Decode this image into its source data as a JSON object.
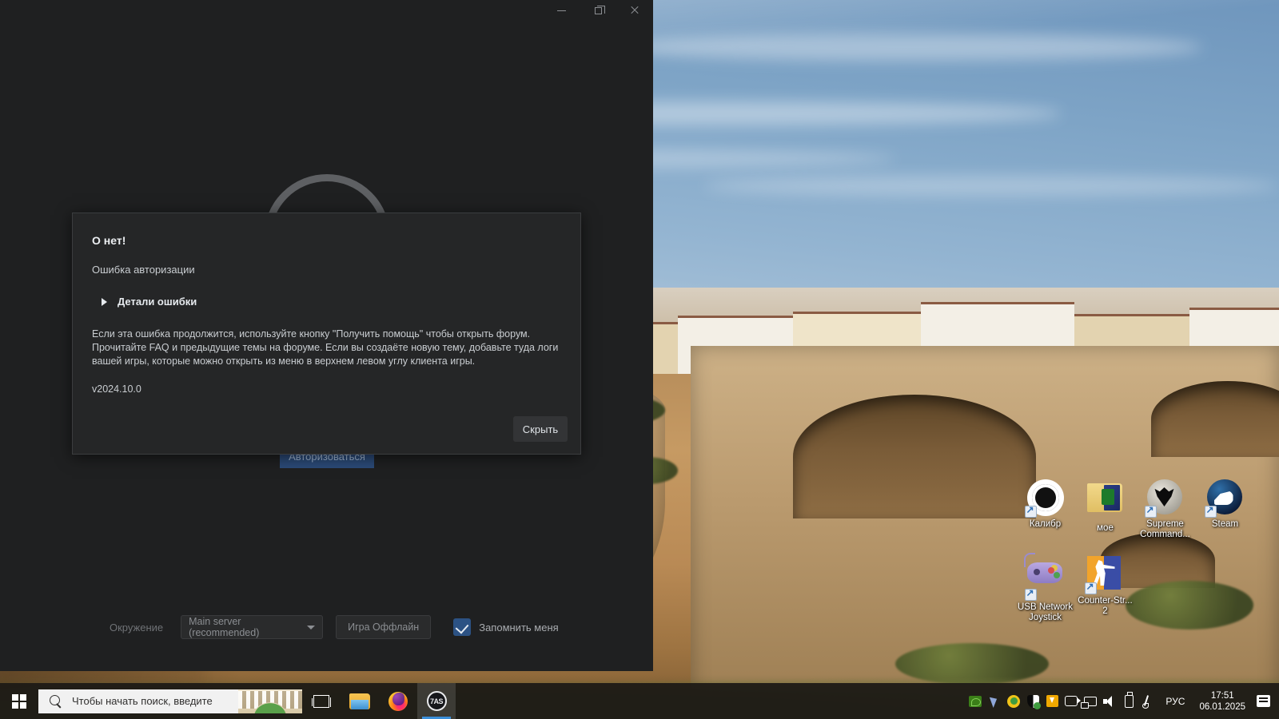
{
  "app": {
    "titlebar": {
      "minimize_label": "Свернуть",
      "restore_label": "Развернуть",
      "close_label": "Закрыть"
    },
    "login_button_label": "Авторизоваться",
    "bottom_bar": {
      "environment_label": "Окружение",
      "server_select_value": "Main server (recommended)",
      "offline_button_label": "Игра Оффлайн",
      "remember_me_label": "Запомнить меня",
      "remember_me_checked": true,
      "checkbox_color": "#2c5284"
    },
    "dialog": {
      "title": "О нет!",
      "subtitle": "Ошибка авторизации",
      "details_toggle_label": "Детали ошибки",
      "details_expanded": false,
      "body": "Если эта ошибка продолжится, используйте кнопку \"Получить помощь\" чтобы открыть форум. Прочитайте FAQ и предыдущие темы на форуме. Если вы создаёте новую тему, добавьте туда логи вашей игры, которые можно открыть из меню в верхнем левом углу клиента игры.",
      "version": "v2024.10.0",
      "hide_button_label": "Скрыть"
    }
  },
  "desktop": {
    "icons": [
      {
        "label": "Калибр",
        "icon": "kalibr-shutter-icon",
        "shortcut": true
      },
      {
        "label": "мое",
        "icon": "folder-icon",
        "shortcut": false
      },
      {
        "label": "Supreme Command...",
        "icon": "supreme-commander-icon",
        "shortcut": true
      },
      {
        "label": "Steam",
        "icon": "steam-icon",
        "shortcut": true
      },
      {
        "label": "USB Network Joystick",
        "icon": "joystick-icon",
        "shortcut": true
      },
      {
        "label": "Counter-Str... 2",
        "icon": "counter-strike-icon",
        "shortcut": true
      }
    ]
  },
  "taskbar": {
    "start_label": "Пуск",
    "search_placeholder": "Чтобы начать поиск, введите",
    "buttons": [
      {
        "name": "task-view",
        "label": "Представление задач"
      },
      {
        "name": "file-explorer",
        "label": "Проводник"
      },
      {
        "name": "firefox",
        "label": "Firefox"
      },
      {
        "name": "game-client",
        "label": "7AS",
        "active": true
      }
    ],
    "tray": {
      "icons": [
        "nvidia-icon",
        "cursor-icon",
        "update-icon",
        "security-shield-icon",
        "download-icon",
        "screen-recorder-icon",
        "display-icon",
        "volume-icon",
        "usb-eject-icon",
        "pen-icon"
      ],
      "language": "РУС",
      "time": "17:51",
      "date": "06.01.2025",
      "notifications_label": "Центр уведомлений"
    }
  }
}
